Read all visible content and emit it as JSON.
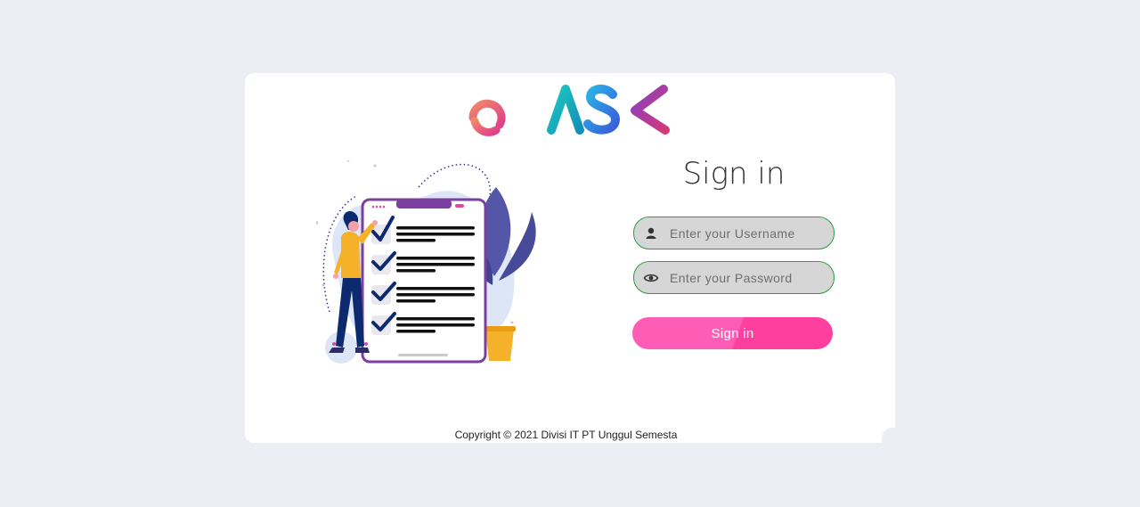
{
  "logo": {
    "text": "eTASK"
  },
  "signin": {
    "title": "Sign in",
    "username": {
      "value": "",
      "placeholder": "Enter your Username",
      "icon": "user-icon"
    },
    "password": {
      "value": "",
      "placeholder": "Enter your Password",
      "icon": "eye-icon"
    },
    "button_label": "Sign in"
  },
  "footer": {
    "copyright": "Copyright © 2021 Divisi IT PT Unggul Semesta"
  },
  "colors": {
    "background": "#ecedf5",
    "card": "#ffffff",
    "field_bg": "#d6d6d6",
    "field_border": "#2f9e3f",
    "button_pink": "#ff4fa8",
    "title": "#333333"
  }
}
